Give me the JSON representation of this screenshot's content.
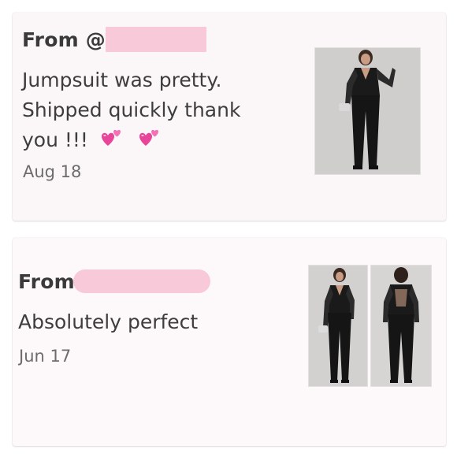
{
  "reviews": [
    {
      "from_label": "From @",
      "message_text": "Jumpsuit was pretty. Shipped quickly thank you !!!",
      "emoji": "heart-emoji",
      "date": "Aug 18",
      "photo_icon": "jumpsuit-photo"
    },
    {
      "from_label": "From",
      "message_text": "Absolutely perfect",
      "date": "Jun 17",
      "photo_icons": [
        "jumpsuit-front-photo",
        "jumpsuit-back-photo"
      ]
    }
  ],
  "colors": {
    "redaction": "#f8c9d8",
    "heart": "#e8459a",
    "card_background": "#fbf7f8",
    "text": "#3a3a3a",
    "date_text": "#6c6c6c"
  }
}
